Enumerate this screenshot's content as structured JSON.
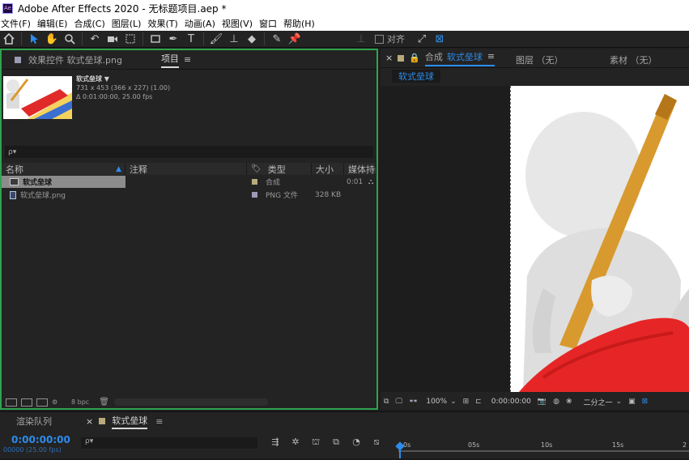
{
  "window": {
    "app_title": "Adobe After Effects 2020 - 无标题项目.aep *",
    "logo_text": "Ae"
  },
  "menu": [
    "文件(F)",
    "编辑(E)",
    "合成(C)",
    "图层(L)",
    "效果(T)",
    "动画(A)",
    "视图(V)",
    "窗口",
    "帮助(H)"
  ],
  "toolbar": {
    "snap_label": "对齐"
  },
  "project_panel": {
    "tabs": [
      {
        "label": "效果控件 软式垒球.png"
      },
      {
        "label": "项目",
        "menu": "≡"
      }
    ],
    "preview": {
      "name": "软式垒球 ▼",
      "dims": "731 x 453  (366 x 227) (1.00)",
      "duration": "Δ 0:01:00:00, 25.00 fps"
    },
    "search_placeholder": "ρ▾",
    "columns": [
      "名称",
      "注释",
      "类型",
      "大小",
      "媒体持续"
    ],
    "rows": [
      {
        "name": "软式垒球",
        "type": "合成",
        "size": "",
        "duration": "0:01",
        "label_color": "#b8aa7a",
        "selected": true
      },
      {
        "name": "软式垒球.png",
        "type": "PNG 文件",
        "size": "328 KB",
        "duration": "",
        "label_color": "#9b9bb6",
        "selected": false
      }
    ],
    "footer_bpc": "8 bpc"
  },
  "comp_panel": {
    "tab_prefix": "合成",
    "comp_name": "软式垒球",
    "layer_tab": "图层 （无）",
    "footage_tab": "素材 （无）",
    "subtab": "软式垒球",
    "zoom": "100%",
    "time": "0:00:00:00",
    "resolution": "二分之一"
  },
  "timeline": {
    "render_queue": "渲染队列",
    "comp_tab": "软式垒球",
    "timecode": "0:00:00:00",
    "framecode": "00000 (25.00 fps)",
    "search_placeholder": "ρ▾",
    "ruler_ticks": [
      "0s",
      "05s",
      "10s",
      "15s",
      "2"
    ]
  },
  "colors": {
    "accent_blue": "#2d8ceb",
    "focus_green": "#2ea44f",
    "panel_bg": "#232323"
  }
}
